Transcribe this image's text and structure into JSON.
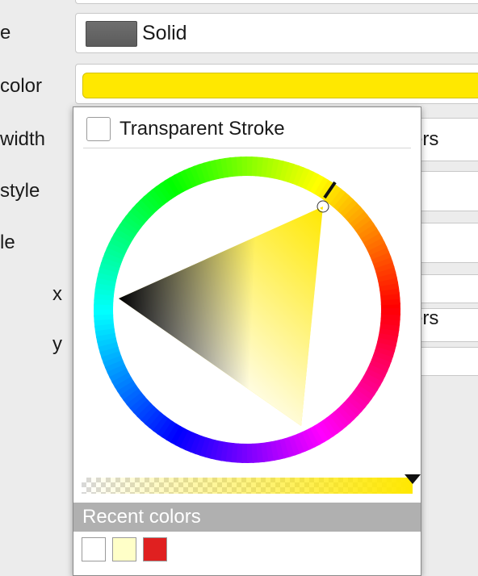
{
  "labels": {
    "style": "e",
    "color": "color",
    "width": "width",
    "join_style": "style",
    "cap_style": "le",
    "offset_x": "x",
    "offset_y": "y"
  },
  "stroke_style": {
    "value": "Solid"
  },
  "stroke_color": {
    "hex": "#ffe800"
  },
  "width_units": "ers",
  "offset_units": "ers",
  "color_popup": {
    "transparent_label": "Transparent Stroke",
    "transparent_checked": false,
    "current_color": "#ffe800",
    "hue_degrees": 55,
    "alpha_percent": 100,
    "recent_header": "Recent colors",
    "recent_colors": [
      "#ffffff",
      "#ffffc8",
      "#e02020"
    ]
  },
  "icons": {
    "alpha_marker": "triangle-down-icon"
  }
}
